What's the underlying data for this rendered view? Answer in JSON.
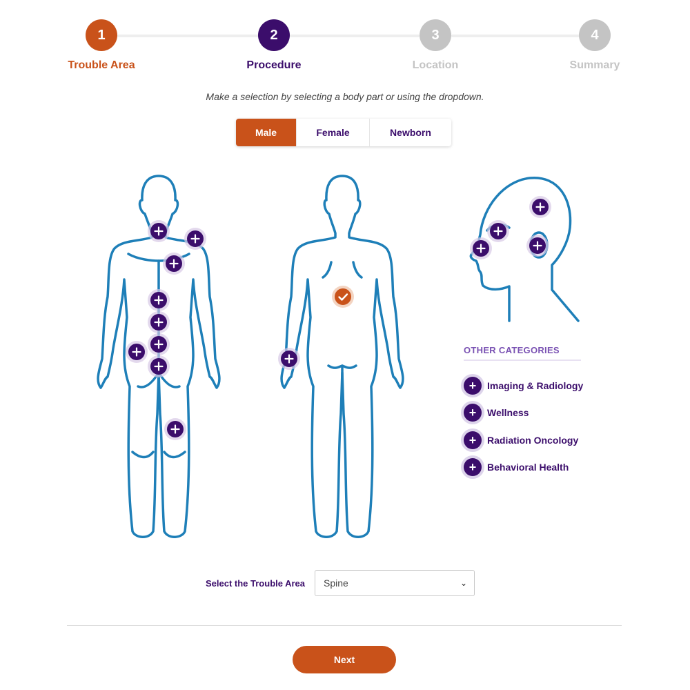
{
  "steps": [
    {
      "number": "1",
      "label": "Trouble Area"
    },
    {
      "number": "2",
      "label": "Procedure"
    },
    {
      "number": "3",
      "label": "Location"
    },
    {
      "number": "4",
      "label": "Summary"
    }
  ],
  "instruction": "Make a selection by selecting a body part or using the dropdown.",
  "gender_tabs": [
    "Male",
    "Female",
    "Newborn"
  ],
  "selected_gender": "Male",
  "other_categories": {
    "title": "OTHER CATEGORIES",
    "items": [
      "Imaging & Radiology",
      "Wellness",
      "Radiation Oncology",
      "Behavioral Health"
    ]
  },
  "trouble_area": {
    "label": "Select the Trouble Area",
    "value": "Spine"
  },
  "next_label": "Next",
  "colors": {
    "accent_orange": "#c9521a",
    "primary_purple": "#3b0d6b",
    "figure_blue": "#1e7fb8",
    "inactive_gray": "#c4c4c4"
  }
}
